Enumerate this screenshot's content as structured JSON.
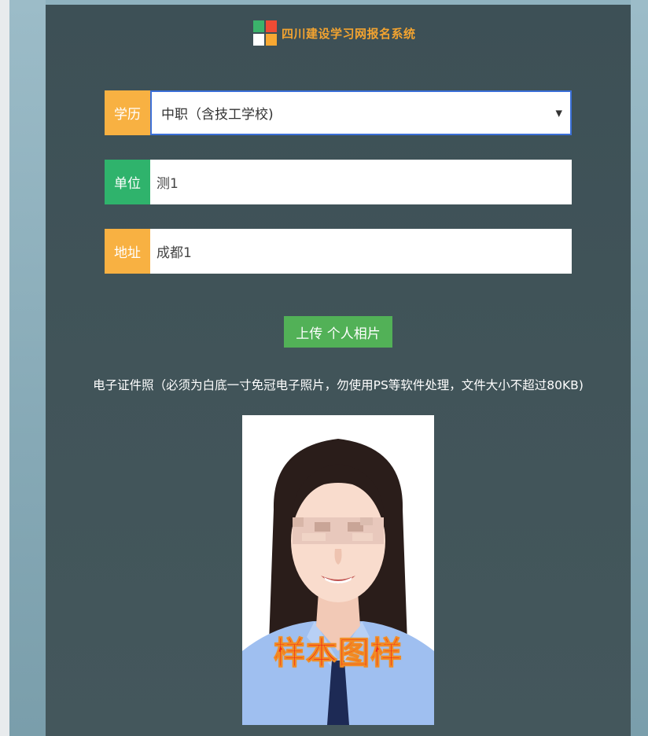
{
  "header": {
    "logo_icon": "windows-like-colored-squares",
    "title": "四川建设学习网报名系统"
  },
  "form": {
    "education": {
      "label": "学历",
      "value": "中职（含技工学校)",
      "label_color": "#f8b142"
    },
    "unit": {
      "label": "单位",
      "value": "测1",
      "label_color": "#2fb36c"
    },
    "address": {
      "label": "地址",
      "value": "成都1",
      "label_color": "#f8b142"
    }
  },
  "upload": {
    "button_label": "上传 个人相片",
    "hint": "电子证件照（必须为白底一寸免冠电子照片，勿使用PS等软件处理，文件大小不超过80KB)"
  },
  "sample_photo": {
    "watermark": "样本图样"
  },
  "colors": {
    "panel": "#41545a",
    "accent_orange": "#f8b142",
    "accent_green": "#2fb36c",
    "button_green": "#52b157",
    "select_border": "#3a6fd8"
  }
}
